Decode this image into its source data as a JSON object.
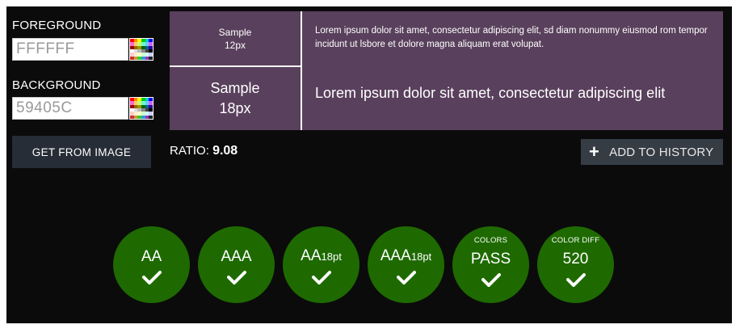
{
  "foreground": {
    "label": "FOREGROUND",
    "value": "FFFFFF"
  },
  "background": {
    "label": "BACKGROUND",
    "value": "59405C"
  },
  "get_from_image_label": "GET FROM IMAGE",
  "samples": {
    "small_label": "Sample",
    "small_size": "12px",
    "large_label": "Sample",
    "large_size": "18px",
    "small_text": "Lorem ipsum dolor sit amet, consectetur adipiscing elit, sd diam nonummy eiusmod rom tempor incidunt ut lsbore et dolore magna aliquam erat volupat.",
    "large_text": "Lorem ipsum dolor sit amet, consectetur adipiscing elit"
  },
  "ratio": {
    "label": "RATIO:",
    "value": "9.08"
  },
  "add_history_label": "ADD TO HISTORY",
  "results": [
    {
      "top": "",
      "main": "AA",
      "suffix": "",
      "status": "pass"
    },
    {
      "top": "",
      "main": "AAA",
      "suffix": "",
      "status": "pass"
    },
    {
      "top": "",
      "main": "AA",
      "suffix": "18pt",
      "status": "pass"
    },
    {
      "top": "",
      "main": "AAA",
      "suffix": "18pt",
      "status": "pass"
    },
    {
      "top": "COLORS",
      "main": "PASS",
      "suffix": "",
      "status": "pass"
    },
    {
      "top": "COLOR DIFF",
      "main": "520",
      "suffix": "",
      "status": "pass"
    }
  ],
  "colors": {
    "panel": "#0b0b0b",
    "sample_bg": "#59405c",
    "pass_green": "#1e6a00",
    "button": "#262d36"
  },
  "icons": {
    "palette": "palette-icon",
    "plus": "plus-icon",
    "check": "check-icon"
  }
}
